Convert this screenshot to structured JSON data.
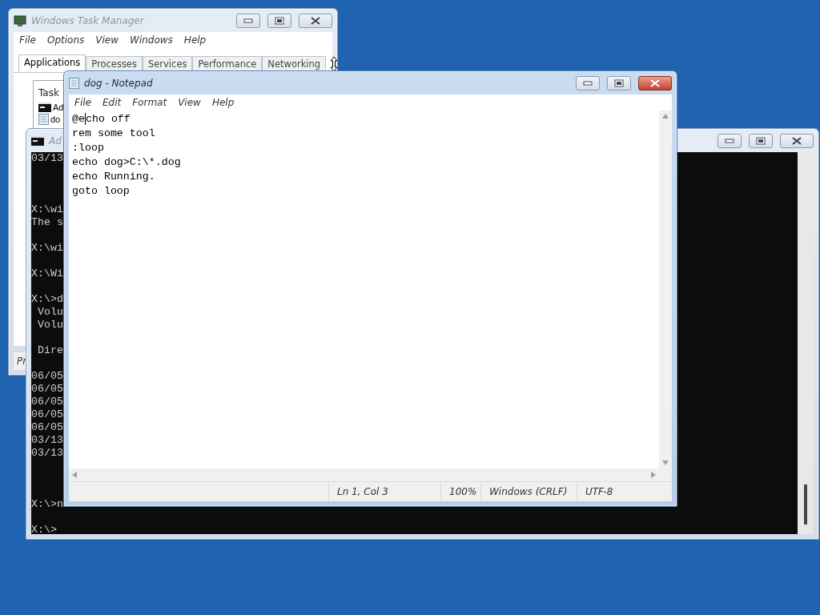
{
  "task_manager": {
    "title": "Windows Task Manager",
    "menu": [
      "File",
      "Options",
      "View",
      "Windows",
      "Help"
    ],
    "tabs": [
      {
        "label": "Applications",
        "selected": true
      },
      {
        "label": "Processes",
        "selected": false
      },
      {
        "label": "Services",
        "selected": false
      },
      {
        "label": "Performance",
        "selected": false
      },
      {
        "label": "Networking",
        "selected": false
      }
    ],
    "list": {
      "header": "Task",
      "items": [
        {
          "label": "Ad",
          "kind": "console"
        },
        {
          "label": "do",
          "kind": "notepad"
        }
      ]
    },
    "status": "Pr"
  },
  "console": {
    "title": "Ad",
    "lines": [
      {
        "kind": "text",
        "text": "03/13"
      },
      {
        "kind": "blank"
      },
      {
        "kind": "blank"
      },
      {
        "kind": "blank"
      },
      {
        "kind": "text",
        "text": "X:\\wi"
      },
      {
        "kind": "text",
        "text": "The s"
      },
      {
        "kind": "blank"
      },
      {
        "kind": "text",
        "text": "X:\\wi"
      },
      {
        "kind": "blank"
      },
      {
        "kind": "text",
        "text": "X:\\Wi"
      },
      {
        "kind": "blank"
      },
      {
        "kind": "text",
        "text": "X:\\>d"
      },
      {
        "kind": "text",
        "text": " Volu"
      },
      {
        "kind": "text",
        "text": " Volu"
      },
      {
        "kind": "blank"
      },
      {
        "kind": "text",
        "text": " Dire"
      },
      {
        "kind": "blank"
      },
      {
        "kind": "text",
        "text": "06/05"
      },
      {
        "kind": "text",
        "text": "06/05"
      },
      {
        "kind": "text",
        "text": "06/05"
      },
      {
        "kind": "text",
        "text": "06/05"
      },
      {
        "kind": "text",
        "text": "06/05"
      },
      {
        "kind": "text",
        "text": "03/13"
      },
      {
        "kind": "text",
        "text": "03/13"
      },
      {
        "kind": "blank"
      },
      {
        "kind": "blank"
      },
      {
        "kind": "blank"
      },
      {
        "kind": "text",
        "text": "X:\\>n"
      },
      {
        "kind": "blank"
      },
      {
        "kind": "text",
        "text": "X:\\>"
      }
    ]
  },
  "notepad": {
    "title": "dog - Notepad",
    "active": true,
    "menu": [
      "File",
      "Edit",
      "Format",
      "View",
      "Help"
    ],
    "lines": [
      {
        "before_caret": "@e",
        "after_caret": "cho off"
      },
      {
        "text": "rem some tool"
      },
      {
        "text": ":loop"
      },
      {
        "text": "echo dog>C:\\*.dog"
      },
      {
        "text": "echo Running."
      },
      {
        "text": "goto loop"
      }
    ],
    "status_bar": [
      "Ln 1, Col 3",
      "100%",
      "Windows (CRLF)",
      "UTF-8"
    ]
  }
}
